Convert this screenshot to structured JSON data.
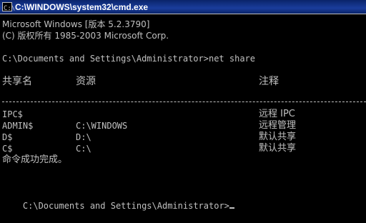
{
  "window": {
    "title": "C:\\WINDOWS\\system32\\cmd.exe"
  },
  "console": {
    "banner_line1": "Microsoft Windows [版本 5.2.3790]",
    "banner_line2": "(C) 版权所有 1985-2003 Microsoft Corp.",
    "prompt1": "C:\\Documents and Settings\\Administrator>net share",
    "headers": {
      "share_name": "共享名",
      "resource": "资源",
      "remark": "注释"
    },
    "separator": "-------------------------------------------------------------------------------",
    "shares": [
      {
        "name": "IPC$",
        "resource": "",
        "remark": "远程 IPC"
      },
      {
        "name": "ADMIN$",
        "resource": "C:\\WINDOWS",
        "remark": "远程管理"
      },
      {
        "name": "D$",
        "resource": "D:\\",
        "remark": "默认共享"
      },
      {
        "name": "C$",
        "resource": "C:\\",
        "remark": "默认共享"
      }
    ],
    "status": "命令成功完成。",
    "prompt2": "C:\\Documents and Settings\\Administrator>"
  },
  "colors": {
    "titlebar": "#0a246a",
    "console_bg": "#000000",
    "console_fg": "#c0c0c0"
  },
  "icons": {
    "window_icon": "cmd-icon"
  }
}
